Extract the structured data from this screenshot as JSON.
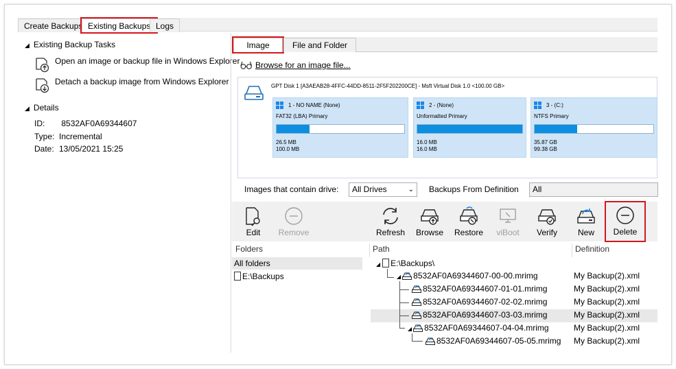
{
  "top_tabs": [
    "Create Backups",
    "Existing Backups",
    "Logs"
  ],
  "left": {
    "tasks_heading": "Existing Backup Tasks",
    "tasks": [
      "Open an image or backup file in Windows Explorer",
      "Detach a backup image from Windows Explorer"
    ],
    "details_heading": "Details",
    "details": {
      "id_label": "ID:",
      "id": "8532AF0A69344607",
      "type_label": "Type:",
      "type": "Incremental",
      "date_label": "Date:",
      "date": "13/05/2021 15:25"
    }
  },
  "inner_tabs": [
    "Image",
    "File and Folder"
  ],
  "browse_label": "Browse for an image file...",
  "disk": {
    "title": "GPT Disk 1 [A3AEAB28-4FFC-44DD-8511-2F5F202200CE] - Msft    Virtual Disk    1.0  <100.00 GB>",
    "partitions": [
      {
        "name": "1 - NO NAME (None)",
        "type": "FAT32 (LBA) Primary",
        "used": "26.5 MB",
        "total": "100.0 MB",
        "fill": 0.26
      },
      {
        "name": "2 - (None)",
        "type": "Unformatted Primary",
        "used": "16.0 MB",
        "total": "16.0 MB",
        "fill": 1.0
      },
      {
        "name": "3 - (C:)",
        "type": "NTFS Primary",
        "used": "35.87 GB",
        "total": "99.38 GB",
        "fill": 0.36
      }
    ]
  },
  "filters": {
    "drive_label": "Images that contain drive:",
    "drive_value": "All Drives",
    "def_label": "Backups From Definition",
    "def_value": "All"
  },
  "toolbar": {
    "edit": "Edit",
    "remove": "Remove",
    "refresh": "Refresh",
    "browse": "Browse",
    "restore": "Restore",
    "viboot": "viBoot",
    "verify": "Verify",
    "new": "New",
    "delete": "Delete"
  },
  "columns": {
    "folders": "Folders",
    "path": "Path",
    "definition": "Definition"
  },
  "folders": [
    "All folders",
    "E:\\Backups"
  ],
  "paths": {
    "root": "E:\\Backups\\",
    "rows": [
      {
        "name": "8532AF0A69344607-00-00.mrimg",
        "def": "My Backup(2).xml"
      },
      {
        "name": "8532AF0A69344607-01-01.mrimg",
        "def": "My Backup(2).xml"
      },
      {
        "name": "8532AF0A69344607-02-02.mrimg",
        "def": "My Backup(2).xml"
      },
      {
        "name": "8532AF0A69344607-03-03.mrimg",
        "def": "My Backup(2).xml"
      },
      {
        "name": "8532AF0A69344607-04-04.mrimg",
        "def": "My Backup(2).xml"
      },
      {
        "name": "8532AF0A69344607-05-05.mrimg",
        "def": "My Backup(2).xml"
      }
    ]
  },
  "colors": {
    "highlight": "#d4161c",
    "accent": "#0e8ee0",
    "partition_bg": "#cfe5f7"
  }
}
